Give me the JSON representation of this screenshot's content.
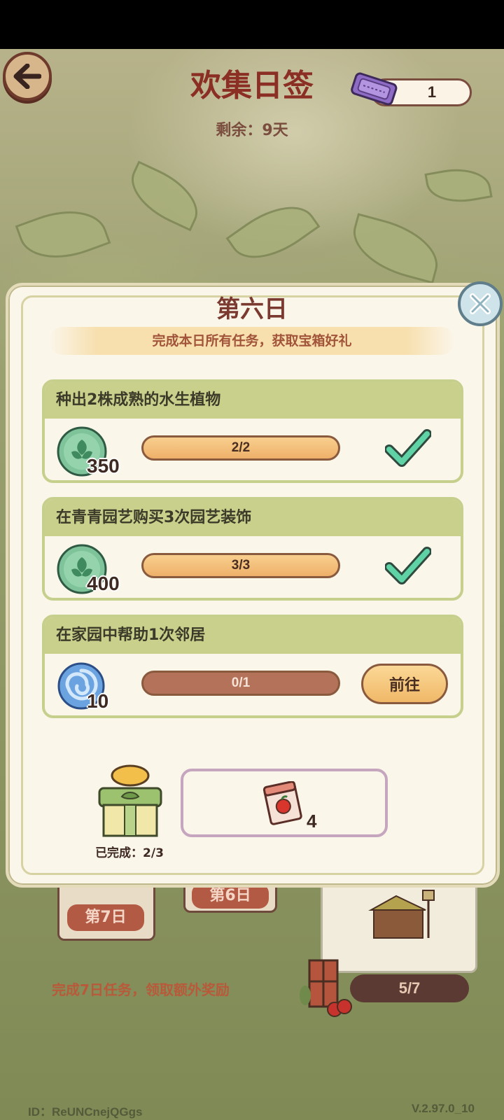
{
  "header": {
    "title": "欢集日签",
    "remaining": "剩余：9天",
    "ticket_count": "1"
  },
  "modal": {
    "title": "第六日",
    "subtitle": "完成本日所有任务，获取宝箱好礼",
    "tasks": [
      {
        "title": "种出2株成熟的水生植物",
        "reward_icon": "leaf-coin-icon",
        "reward_amount": "350",
        "progress_text": "2/2",
        "progress": 1.0,
        "status": "completed"
      },
      {
        "title": "在青青园艺购买3次园艺装饰",
        "reward_icon": "leaf-coin-icon",
        "reward_amount": "400",
        "progress_text": "3/3",
        "progress": 1.0,
        "status": "completed"
      },
      {
        "title": "在家园中帮助1次邻居",
        "reward_icon": "blue-swirl-icon",
        "reward_amount": "10",
        "progress_text": "0/1",
        "progress": 0.0,
        "status": "pending",
        "action_label": "前往"
      }
    ],
    "gift_progress": "已完成：2/3",
    "reward_count": "4"
  },
  "background": {
    "day7_label": "第7日",
    "day6_label": "第6日",
    "extra_tip": "完成7日任务，领取额外奖励",
    "week_progress": "5/7"
  },
  "footer": {
    "id_text": "ID：ReUNCnejQGgs",
    "version": "V.2.97.0_10"
  },
  "colors": {
    "title": "#8b2e24",
    "task_header": "#c8d08c",
    "bar_fill": "#eeb06a",
    "check": "#4fbf9a"
  }
}
